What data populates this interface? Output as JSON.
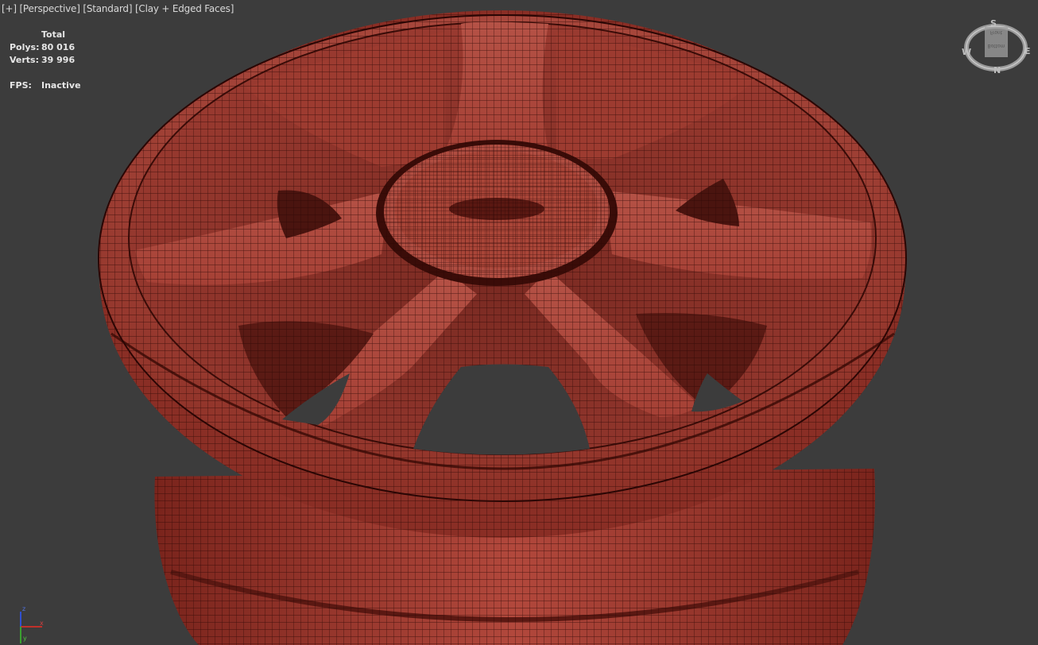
{
  "viewport": {
    "label_parts": [
      "[+]",
      "[Perspective]",
      "[Standard]",
      "[Clay + Edged Faces]"
    ],
    "stats": {
      "header": "Total",
      "polys_label": "Polys:",
      "polys_value": "80 016",
      "verts_label": "Verts:",
      "verts_value": "39 996",
      "fps_label": "FPS:",
      "fps_value": "Inactive"
    },
    "viewcube": {
      "north": "N",
      "south": "S",
      "east": "E",
      "west": "W",
      "face_top": "Front",
      "face_main": "Bottom"
    },
    "axis_gizmo": {
      "z": "z",
      "x": "x",
      "y": "y"
    },
    "colors": {
      "background": "#3c3c3c",
      "clay": "#a8473b",
      "edge": "#3a0c08",
      "axis_x": "#c0302a",
      "axis_y": "#3aa030",
      "axis_z": "#3050d0"
    }
  }
}
